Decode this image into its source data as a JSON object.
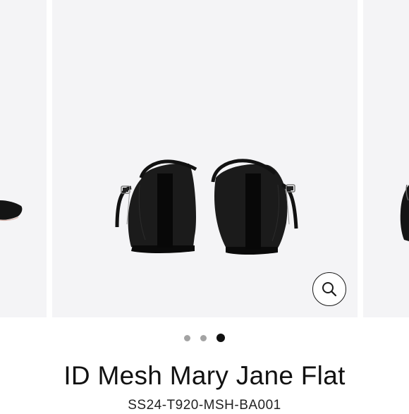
{
  "product": {
    "title": "ID Mesh Mary Jane Flat",
    "sku": "SS24-T920-MSH-BA001"
  },
  "gallery": {
    "image_count": 3,
    "active_index": 2,
    "zoom_icon": "magnifier-icon"
  },
  "colors": {
    "panel_bg": "#f4f4f6",
    "shoe": "#141414",
    "active_dot": "#111111",
    "inactive_dot": "#a3a3a3"
  }
}
